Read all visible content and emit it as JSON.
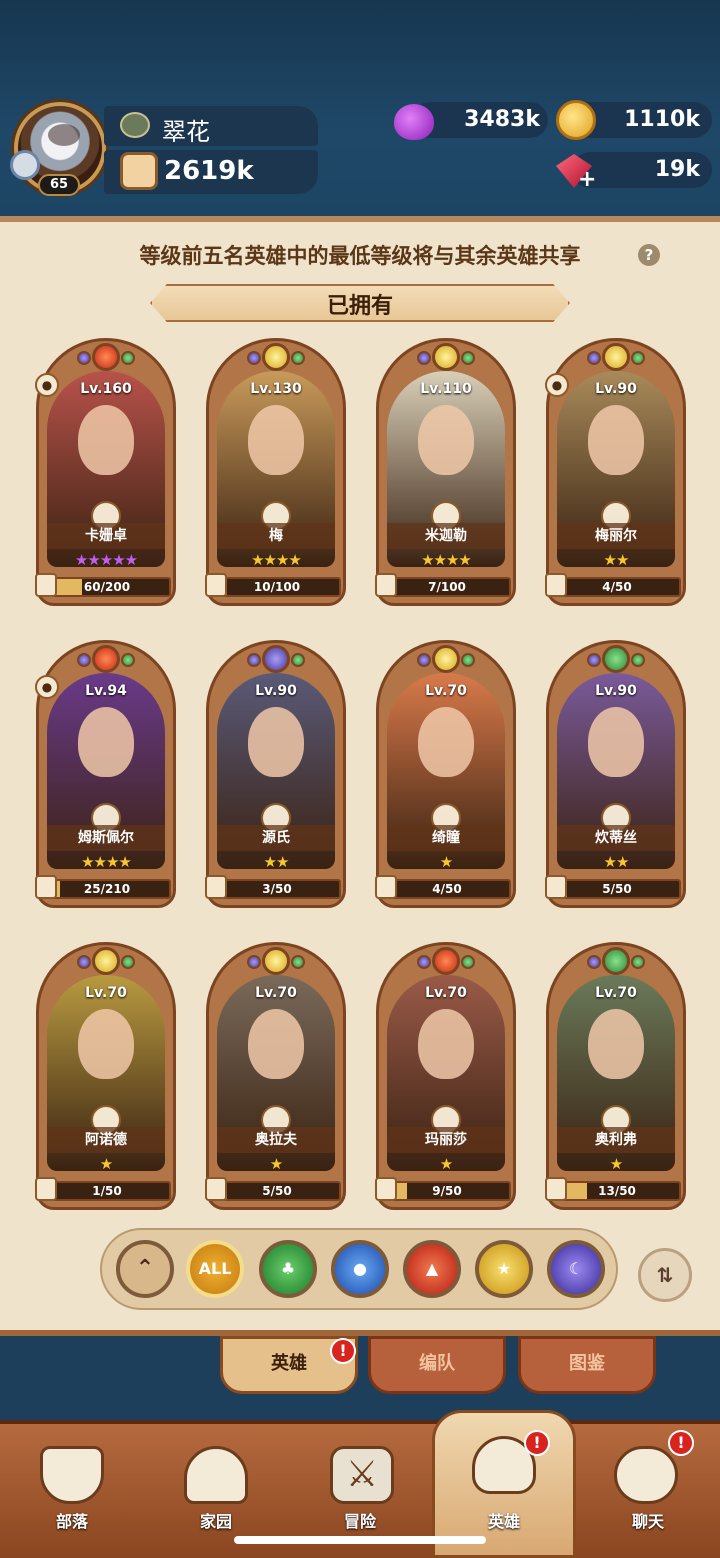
{
  "player": {
    "name": "翠花",
    "level": "65",
    "power": "2619k"
  },
  "resources": {
    "potion": "3483k",
    "gold": "1110k",
    "gems": "19k"
  },
  "notice": "等级前五名英雄中的最低等级将与其余英雄共享",
  "section_title": "已拥有",
  "heroes": [
    {
      "name": "卡姗卓",
      "level": "Lv.160",
      "stars": "★★★★★",
      "star_color": "#c060f0",
      "progress": "60/200",
      "progress_ratio": 0.3,
      "element": "fire",
      "art_color": "#b8524a"
    },
    {
      "name": "梅",
      "level": "Lv.130",
      "stars": "★★★★",
      "star_color": "#f6c830",
      "progress": "10/100",
      "progress_ratio": 0.1,
      "element": "light",
      "art_color": "#c89a5a"
    },
    {
      "name": "米迦勒",
      "level": "Lv.110",
      "stars": "★★★★",
      "star_color": "#f6c830",
      "progress": "7/100",
      "progress_ratio": 0.07,
      "element": "light",
      "art_color": "#d8cfb8"
    },
    {
      "name": "梅丽尔",
      "level": "Lv.90",
      "stars": "★★",
      "star_color": "#f6c830",
      "progress": "4/50",
      "progress_ratio": 0.08,
      "element": "light",
      "art_color": "#a88a5a"
    },
    {
      "name": "姆斯佩尔",
      "level": "Lv.94",
      "stars": "★★★★",
      "star_color": "#f6c830",
      "progress": "25/210",
      "progress_ratio": 0.12,
      "element": "fire",
      "art_color": "#6a3a8a"
    },
    {
      "name": "源氏",
      "level": "Lv.90",
      "stars": "★★",
      "star_color": "#f6c830",
      "progress": "3/50",
      "progress_ratio": 0.06,
      "element": "dark",
      "art_color": "#5a5a78"
    },
    {
      "name": "绮瞳",
      "level": "Lv.70",
      "stars": "★",
      "star_color": "#f6c830",
      "progress": "4/50",
      "progress_ratio": 0.08,
      "element": "light",
      "art_color": "#d87a4a"
    },
    {
      "name": "炊蒂丝",
      "level": "Lv.90",
      "stars": "★★",
      "star_color": "#f6c830",
      "progress": "5/50",
      "progress_ratio": 0.1,
      "element": "nature",
      "art_color": "#7a5a9a"
    },
    {
      "name": "阿诺德",
      "level": "Lv.70",
      "stars": "★",
      "star_color": "#f6c830",
      "progress": "1/50",
      "progress_ratio": 0.02,
      "element": "light",
      "art_color": "#b89a40"
    },
    {
      "name": "奥拉夫",
      "level": "Lv.70",
      "stars": "★",
      "star_color": "#f6c830",
      "progress": "5/50",
      "progress_ratio": 0.1,
      "element": "light",
      "art_color": "#7a6a5a"
    },
    {
      "name": "玛丽莎",
      "level": "Lv.70",
      "stars": "★",
      "star_color": "#f6c830",
      "progress": "9/50",
      "progress_ratio": 0.18,
      "element": "fire",
      "art_color": "#9a5a48"
    },
    {
      "name": "奥利弗",
      "level": "Lv.70",
      "stars": "★",
      "star_color": "#f6c830",
      "progress": "13/50",
      "progress_ratio": 0.26,
      "element": "nature",
      "art_color": "#6a7a5a"
    }
  ],
  "filters": {
    "collapse_icon": "double-chevron-up-icon",
    "all_label": "ALL",
    "nature_icon": "leaf-icon",
    "water_icon": "water-drop-icon",
    "fire_icon": "flame-icon",
    "light_icon": "sun-star-icon",
    "dark_icon": "moon-icon",
    "sort_icon": "sort-icon"
  },
  "subtabs": [
    "英雄",
    "编队",
    "图鉴"
  ],
  "nav": [
    "部落",
    "家园",
    "冒险",
    "英雄",
    "聊天"
  ],
  "colors": {
    "fire": "#c82a18",
    "light": "#d8a818",
    "dark": "#4a3aa6",
    "nature": "#2a8a3a",
    "water": "#2a6ad8"
  }
}
